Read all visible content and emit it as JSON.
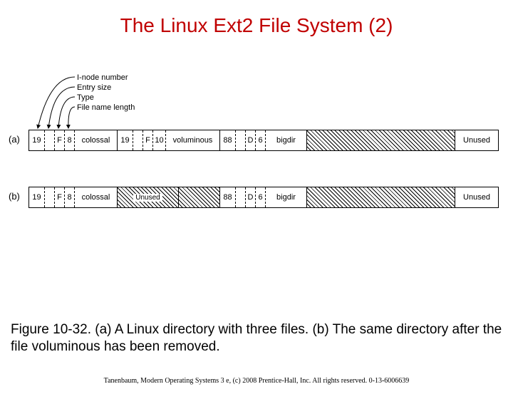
{
  "title": "The Linux Ext2 File System (2)",
  "field_labels": {
    "l1": "I-node number",
    "l2": "Entry size",
    "l3": "Type",
    "l4": "File name length"
  },
  "row_a": {
    "label": "(a)",
    "cells": [
      "19",
      "",
      "F",
      "8",
      "colossal",
      "19",
      "",
      "F",
      "10",
      "voluminous",
      "88",
      "",
      "D",
      "6",
      "bigdir"
    ],
    "unused": "Unused"
  },
  "row_b": {
    "label": "(b)",
    "cells": [
      "19",
      "",
      "F",
      "8",
      "colossal"
    ],
    "unused1": "Unused",
    "cells2": [
      "88",
      "",
      "D",
      "6",
      "bigdir"
    ],
    "unused2": "Unused"
  },
  "caption": "Figure 10-32. (a) A Linux directory with three files. (b) The same directory after the file voluminous has been removed.",
  "credit": "Tanenbaum, Modern Operating Systems 3 e, (c) 2008 Prentice-Hall, Inc. All rights reserved. 0-13-6006639",
  "chart_data": {
    "type": "table",
    "title": "Ext2 directory entry layout before and after removing 'voluminous'",
    "fields": [
      "I-node number",
      "Entry size",
      "Type",
      "File name length",
      "File name"
    ],
    "rows": [
      {
        "id": "a",
        "description": "Directory with three files",
        "entries": [
          {
            "inode": 19,
            "type": "F",
            "name_len": 8,
            "name": "colossal"
          },
          {
            "inode": 19,
            "type": "F",
            "name_len": 10,
            "name": "voluminous"
          },
          {
            "inode": 88,
            "type": "D",
            "name_len": 6,
            "name": "bigdir"
          }
        ],
        "trailing_unused": true
      },
      {
        "id": "b",
        "description": "After removing voluminous",
        "entries": [
          {
            "inode": 19,
            "type": "F",
            "name_len": 8,
            "name": "colossal"
          },
          {
            "unused": true
          },
          {
            "inode": 88,
            "type": "D",
            "name_len": 6,
            "name": "bigdir"
          }
        ],
        "trailing_unused": true
      }
    ]
  }
}
